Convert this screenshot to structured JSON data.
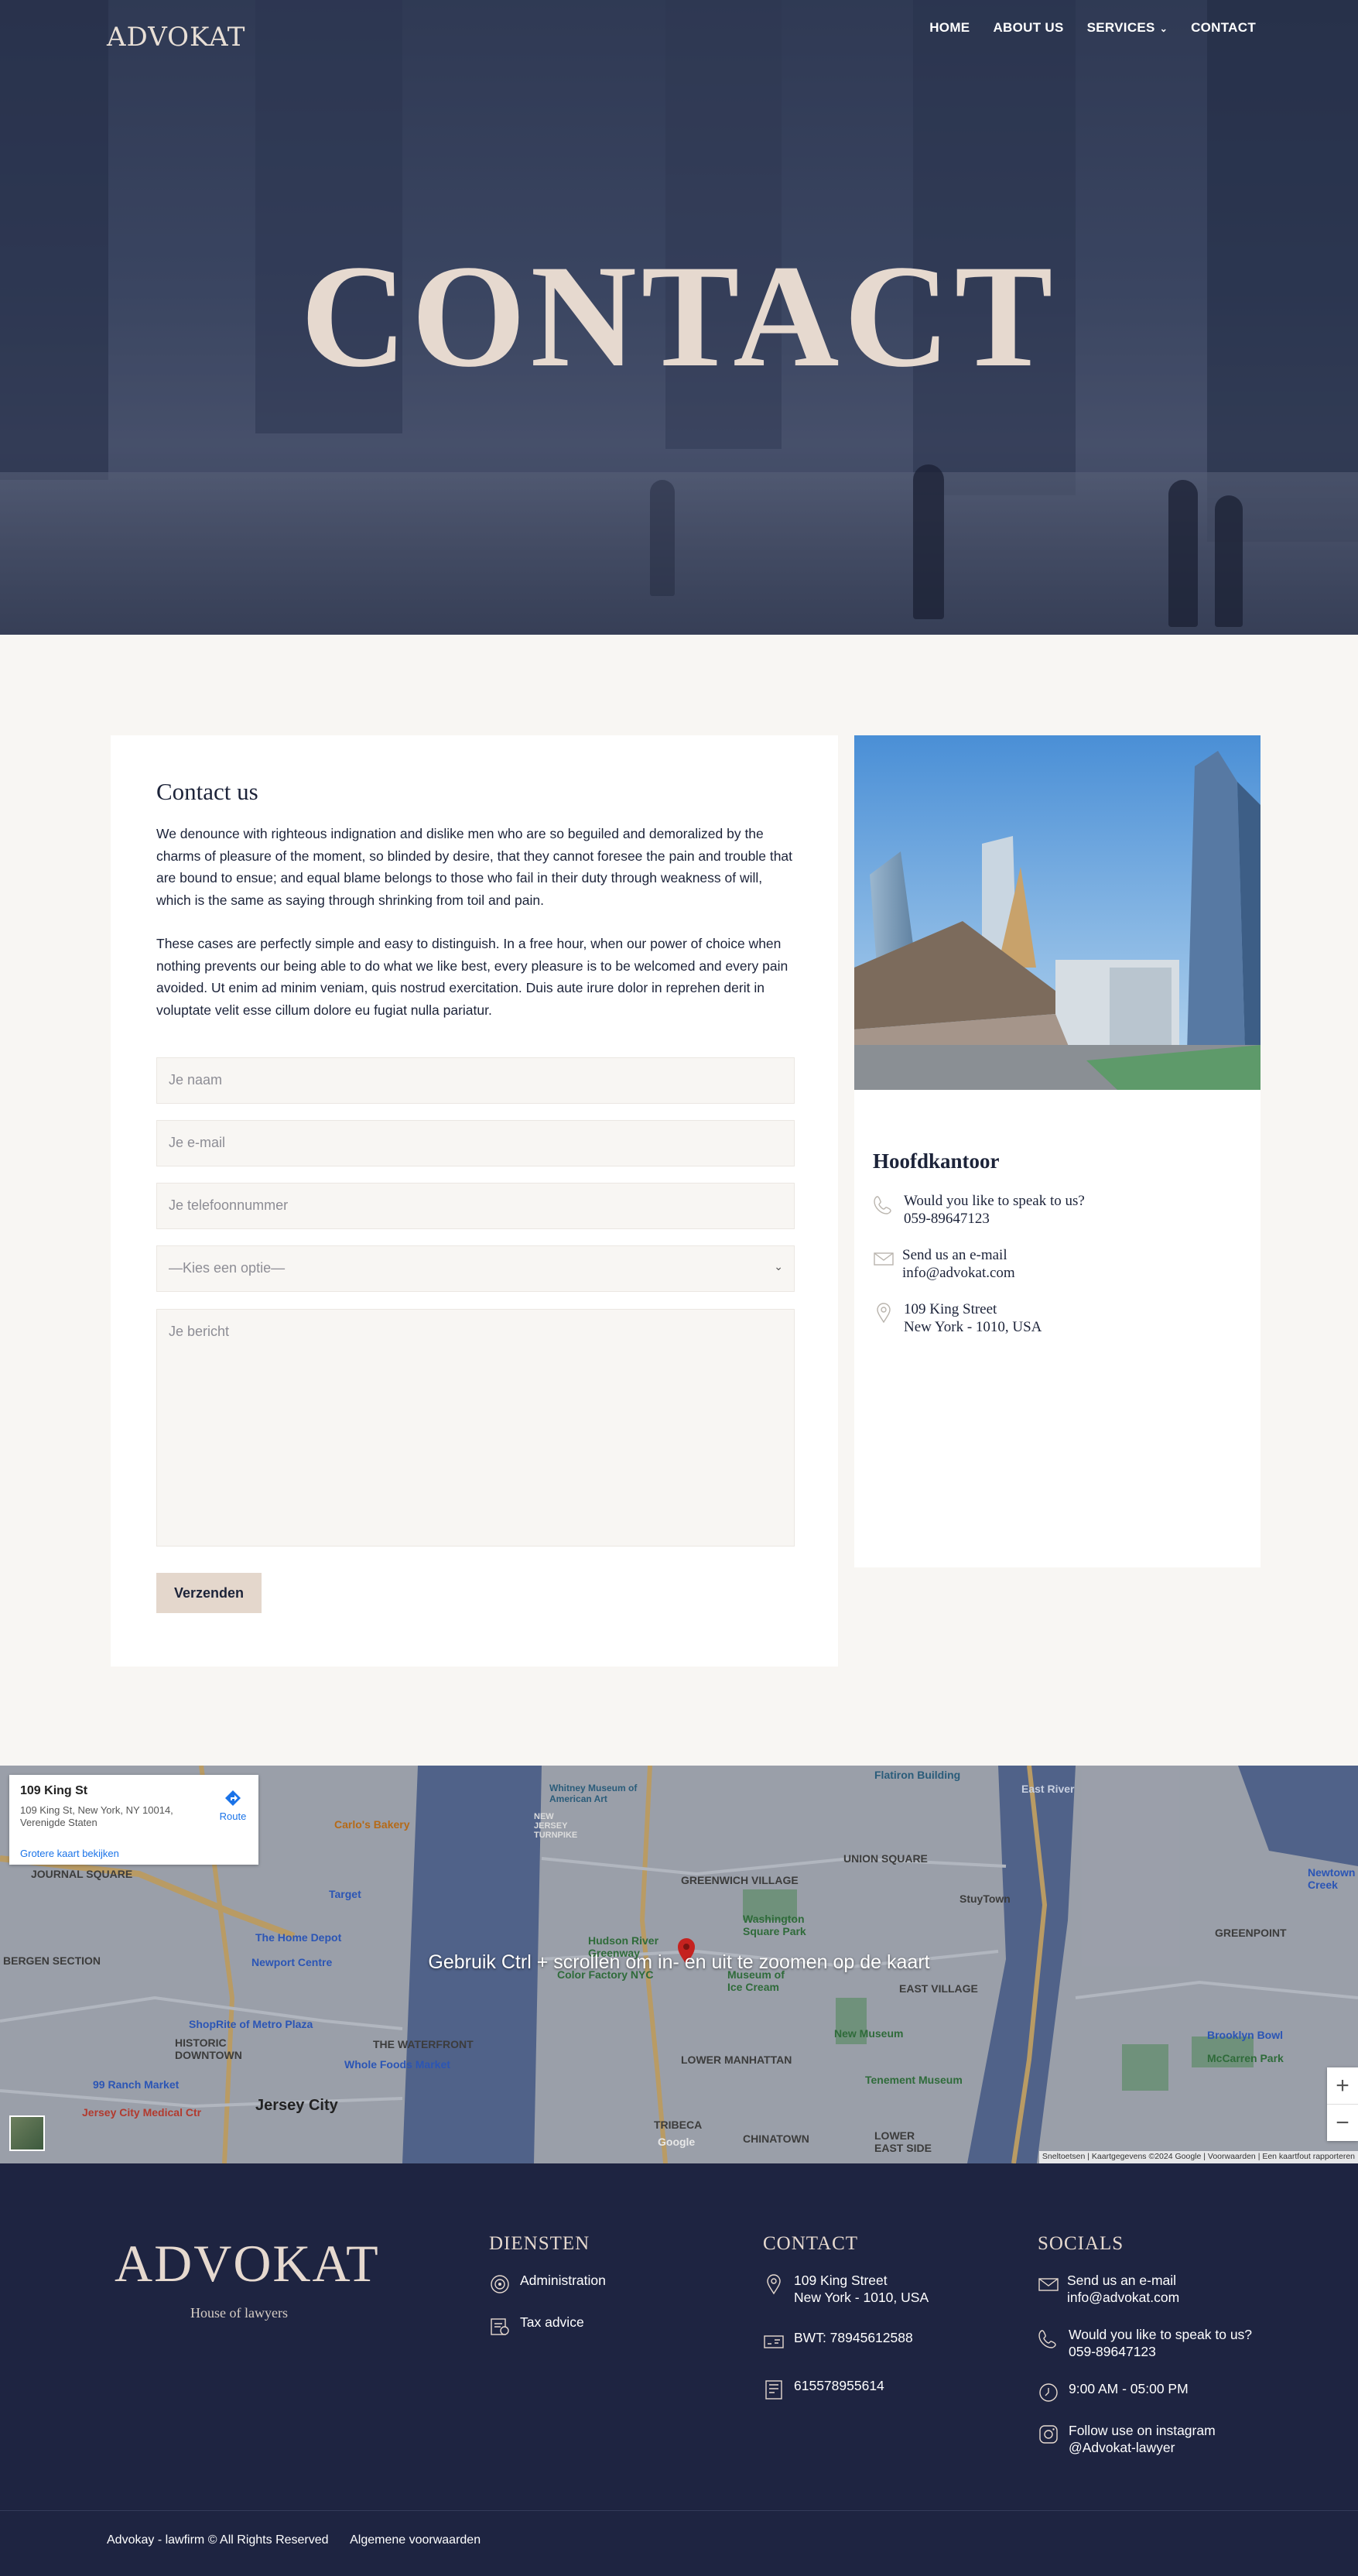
{
  "header": {
    "logo": "ADVOKAT",
    "nav": [
      {
        "label": "HOME"
      },
      {
        "label": "ABOUT US"
      },
      {
        "label": "SERVICES"
      },
      {
        "label": "CONTACT"
      }
    ]
  },
  "hero": {
    "title": "CONTACT"
  },
  "contact_form": {
    "heading": "Contact us",
    "paragraph1": "We denounce with righteous indignation and dislike men who are so beguiled and demoralized by the charms of pleasure of the moment, so blinded by desire, that they cannot foresee the pain and trouble that are bound to ensue; and equal blame belongs to those who fail in their duty through weakness of will, which is the same as saying through shrinking from toil and pain.",
    "paragraph2": "These cases are perfectly simple and easy to distinguish. In a free hour, when our power of choice when nothing prevents our being able to do what we like best, every pleasure is to be welcomed and every pain avoided. Ut enim ad minim veniam, quis nostrud exercitation. Duis aute irure dolor in reprehen derit in voluptate velit esse cillum dolore eu fugiat nulla pariatur.",
    "name_placeholder": "Je naam",
    "email_placeholder": "Je e-mail",
    "phone_placeholder": "Je telefoonnummer",
    "select_value": "—Kies een optie—",
    "message_placeholder": "Je bericht",
    "submit_label": "Verzenden"
  },
  "office": {
    "title": "Hoofdkantoor",
    "phone_label": "Would you like to speak to us?",
    "phone": "059-89647123",
    "email_label": "Send us an e-mail",
    "email": "info@advokat.com",
    "street": "109 King Street",
    "city": "New York - 1010, USA"
  },
  "map": {
    "place_title": "109 King St",
    "place_address": "109 King St, New York, NY 10014, Verenigde Staten",
    "larger_map_link": "Grotere kaart bekijken",
    "route_label": "Route",
    "scroll_message": "Gebruik Ctrl + scrollen om in- en uit te zoomen op de kaart",
    "zoom_in": "+",
    "zoom_out": "−",
    "google": "Google",
    "attribution": "Sneltoetsen | Kaartgegevens ©2024 Google | Voorwaarden | Een kaartfout rapporteren",
    "labels": {
      "flatiron": "Flatiron Building",
      "whitney": "Whitney Museum of American Art",
      "carlos": "Carlo's Bakery",
      "union": "UNION SQUARE",
      "stuytown": "StuyTown",
      "greenwich": "GREENWICH VILLAGE",
      "washington": "Washington Square Park",
      "journal": "JOURNAL SQUARE",
      "target": "Target",
      "homedepot": "The Home Depot",
      "newport": "Newport Centre",
      "hudson": "Hudson River Greenway",
      "intrepid": "Color Factory NYC",
      "museum": "Museum of Ice Cream",
      "eastvillage": "EAST VILLAGE",
      "greenpoint": "GREENPOINT",
      "bergen": "BERGEN SECTION",
      "shoprite": "ShopRite of Metro Plaza",
      "historic": "HISTORIC DOWNTOWN",
      "waterfront": "THE WATERFRONT",
      "wholefoods": "Whole Foods Market",
      "newmuseum": "New Museum",
      "lowermanhattan": "LOWER MANHATTAN",
      "tenement": "Tenement Museum",
      "brooklynbowl": "Brooklyn Bowl",
      "mccarren": "McCarren Park",
      "ranch": "99 Ranch Market",
      "jcmedical": "Jersey City Medical Ctr",
      "jerseycity": "Jersey City",
      "tribeca": "TRIBECA",
      "chinatown": "CHINATOWN",
      "lowereast": "LOWER EAST SIDE",
      "newtown": "Newtown Creek",
      "eastriver": "East River",
      "njturnpike": "NEW JERSEY TURNPIKE"
    }
  },
  "footer": {
    "logo": "ADVOKAT",
    "tagline": "House of lawyers",
    "services_title": "DIENSTEN",
    "services": [
      "Administration",
      "Tax advice"
    ],
    "contact_title": "CONTACT",
    "contact_street": "109 King Street",
    "contact_city": "New York - 1010, USA",
    "contact_btw": "BWT: 78945612588",
    "contact_kvk": "615578955614",
    "socials_title": "SOCIALS",
    "email_label": "Send us an e-mail",
    "email": "info@advokat.com",
    "phone_label": "Would you like to speak to us?",
    "phone": "059-89647123",
    "hours": "9:00 AM - 05:00 PM",
    "insta_label": "Follow use on instagram",
    "insta_handle": "@Advokat-lawyer",
    "copyright": "Advokay - lawfirm © All Rights Reserved",
    "terms": "Algemene voorwaarden"
  },
  "colors": {
    "navy": "#1e2441",
    "sand": "#e4d7cc",
    "page_bg": "#f8f6f3"
  }
}
